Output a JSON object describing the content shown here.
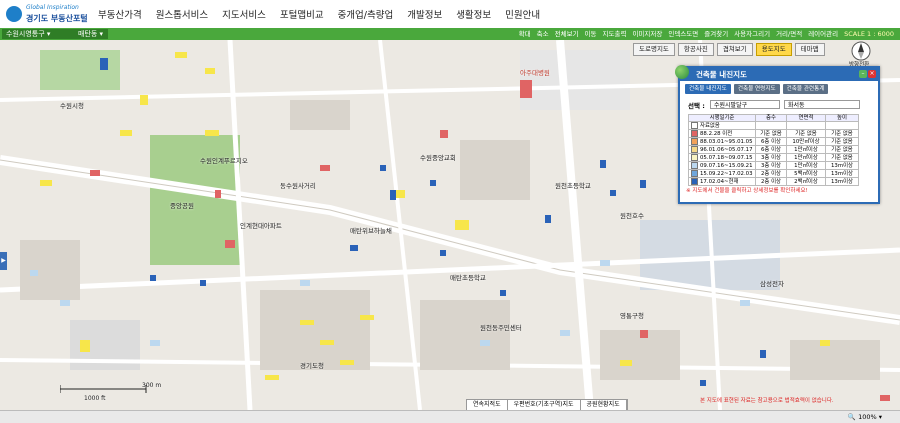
{
  "header": {
    "logo_small": "Global Inspiration",
    "logo_main": "경기도 부동산포털",
    "nav": [
      "부동산가격",
      "원스톱서비스",
      "지도서비스",
      "포털맵비교",
      "중개업/측량업",
      "개발정보",
      "생활정보",
      "민원안내"
    ]
  },
  "toolbar": {
    "district": "수원시영통구",
    "dong": "매탄동",
    "links": [
      "확대",
      "축소",
      "전체보기",
      "이동",
      "지도출력",
      "이미지저장",
      "인덱스도면",
      "즐겨찾기",
      "사용자그리기",
      "거리/면적",
      "레이어관리"
    ],
    "scale": "SCALE 1 : 6000"
  },
  "map_tabs": [
    {
      "label": "도로명지도",
      "active": false
    },
    {
      "label": "항공사진",
      "active": false
    },
    {
      "label": "겹쳐보기",
      "active": false
    },
    {
      "label": "용도지도",
      "active": true
    },
    {
      "label": "테마맵",
      "active": false
    }
  ],
  "compass_label": "방향전환",
  "panel": {
    "title": "건축물 내진지도",
    "tabs": [
      {
        "label": "건축물 내진지도",
        "active": true
      },
      {
        "label": "건축물 연령지도",
        "active": false
      },
      {
        "label": "건축물 관련통계",
        "active": false
      }
    ],
    "select_label": "선택 :",
    "select_values": [
      "수원시팔달구",
      "화서동"
    ],
    "table_headers": [
      "시행일기준",
      "층수",
      "연면적",
      "높이"
    ],
    "table_rows": [
      [
        "자료없음",
        "",
        "",
        ""
      ],
      [
        "88.2.28 이전",
        "기준 없음",
        "기준 없음",
        "기준 없음"
      ],
      [
        "88.03.01~95.01.05",
        "6층 이상",
        "10만㎡이상",
        "기준 없음"
      ],
      [
        "96.01.06~05.07.17",
        "6층 이상",
        "1만㎡이상",
        "기준 없음"
      ],
      [
        "05.07.18~09.07.15",
        "3층 이상",
        "1만㎡이상",
        "기준 없음"
      ],
      [
        "09.07.16~15.09.21",
        "3층 이상",
        "1만㎡이상",
        "13m이상"
      ],
      [
        "15.09.22~17.02.03",
        "2층 이상",
        "5백㎡이상",
        "13m이상"
      ],
      [
        "17.02.04~현재",
        "2층 이상",
        "2백㎡이상",
        "13m이상"
      ]
    ],
    "row_colors": [
      "#ffffff",
      "#e06464",
      "#f2a15a",
      "#f6d98a",
      "#f9f3c3",
      "#bcd8ef",
      "#6fa6db",
      "#2a62b8"
    ],
    "note": "※ 지도에서 건물을 클릭하고 상세정보를 확인하세요!"
  },
  "map_labels": [
    {
      "text": "아주대병원",
      "color": "#c0392b"
    },
    {
      "text": "원천초등학교",
      "color": "#222"
    },
    {
      "text": "수원인계푸르지오",
      "color": "#222"
    },
    {
      "text": "인계현대아파트",
      "color": "#222"
    },
    {
      "text": "중앙공원",
      "color": "#222"
    },
    {
      "text": "원천호수",
      "color": "#222"
    },
    {
      "text": "수원중앙교회",
      "color": "#222"
    },
    {
      "text": "매탄위브하늘채",
      "color": "#222"
    },
    {
      "text": "삼성전자",
      "color": "#222"
    },
    {
      "text": "매탄초등학교",
      "color": "#222"
    },
    {
      "text": "원천동주민센터",
      "color": "#222"
    },
    {
      "text": "동수원사거리",
      "color": "#222"
    },
    {
      "text": "영통구청",
      "color": "#222"
    },
    {
      "text": "수원시청",
      "color": "#222"
    },
    {
      "text": "경기도청",
      "color": "#222"
    }
  ],
  "scale_labels": [
    "300 m",
    "1000 ft"
  ],
  "bottom_bar": [
    "연속지적도",
    "우편번호(기초구역)지도",
    "공원현황지도"
  ],
  "bottom_note": "본 지도에 표현된 자료는 참고용으로 법적효력이 없습니다.",
  "zoom": "100%"
}
